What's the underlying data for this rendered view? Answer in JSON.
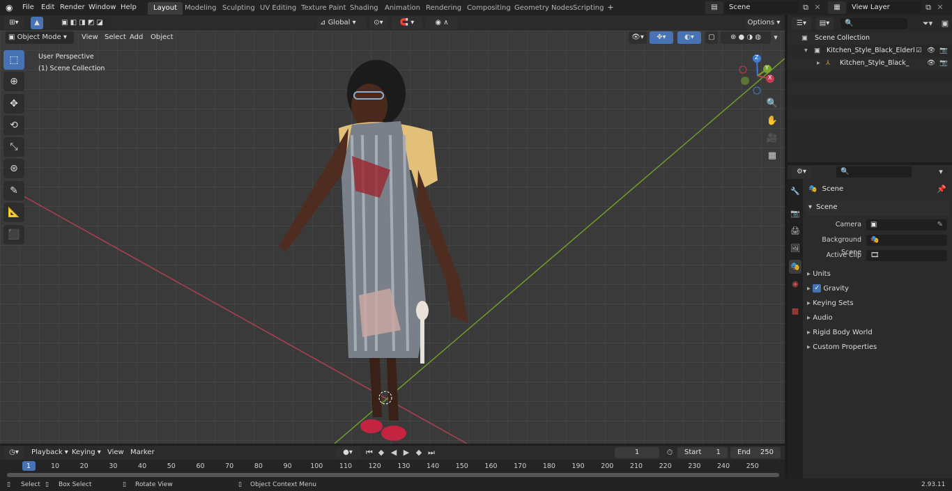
{
  "topbar": {
    "menus": [
      "File",
      "Edit",
      "Render",
      "Window",
      "Help"
    ],
    "workspaces": [
      "Layout",
      "Modeling",
      "Sculpting",
      "UV Editing",
      "Texture Paint",
      "Shading",
      "Animation",
      "Rendering",
      "Compositing",
      "Geometry Nodes",
      "Scripting"
    ],
    "active_workspace": "Layout",
    "scene_name": "Scene",
    "view_layer": "View Layer"
  },
  "viewport_header": {
    "mode": "Object Mode",
    "menus": [
      "View",
      "Select",
      "Add",
      "Object"
    ],
    "transform_orientation": "Global",
    "options_label": "Options"
  },
  "viewport": {
    "overlay_line1": "User Perspective",
    "overlay_line2": "(1) Scene Collection",
    "gizmo_axes": [
      "X",
      "Y",
      "Z"
    ],
    "colors": {
      "x_axis": "#c43c4e",
      "y_axis": "#7aa625",
      "z_axis": "#3a7bd5",
      "grid": "#444444",
      "bg": "#3a3a3a"
    }
  },
  "outliner": {
    "root": "Scene Collection",
    "items": [
      "Kitchen_Style_Black_Elderly_W",
      "Kitchen_Style_Black_Elde"
    ]
  },
  "properties": {
    "context_title": "Scene",
    "panel_title": "Scene",
    "fields": [
      {
        "label": "Camera"
      },
      {
        "label": "Background Scene"
      },
      {
        "label": "Active Clip"
      }
    ],
    "subpanels": [
      "Units",
      "Gravity",
      "Keying Sets",
      "Audio",
      "Rigid Body World",
      "Custom Properties"
    ],
    "gravity_checked": true
  },
  "timeline": {
    "menus": [
      "Playback",
      "Keying",
      "View",
      "Marker"
    ],
    "current_frame": "1",
    "start_label": "Start",
    "start_value": "1",
    "end_label": "End",
    "end_value": "250",
    "ticks": [
      "1",
      "10",
      "20",
      "30",
      "40",
      "50",
      "60",
      "70",
      "80",
      "90",
      "100",
      "110",
      "120",
      "130",
      "140",
      "150",
      "160",
      "170",
      "180",
      "190",
      "200",
      "210",
      "220",
      "230",
      "240",
      "250"
    ]
  },
  "statusbar": {
    "select": "Select",
    "box_select": "Box Select",
    "rotate_view": "Rotate View",
    "context_menu": "Object Context Menu",
    "version": "2.93.11"
  }
}
